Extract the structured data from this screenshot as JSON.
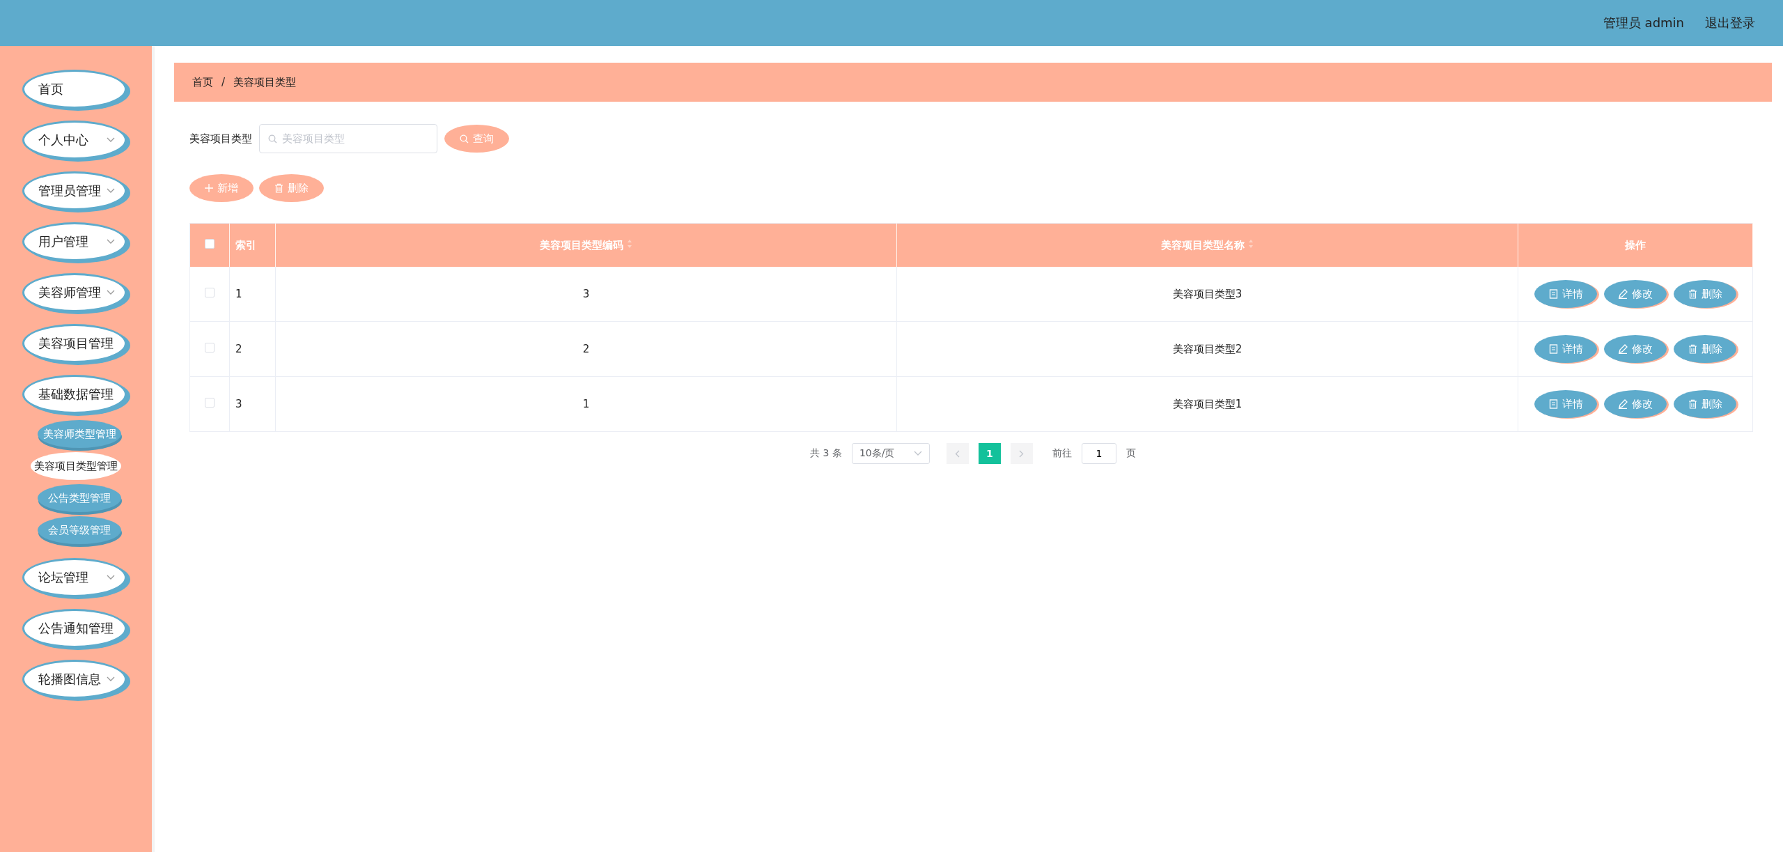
{
  "header": {
    "user": "管理员 admin",
    "logout": "退出登录"
  },
  "sidebar": {
    "items": [
      {
        "label": "首页",
        "has_arrow": false
      },
      {
        "label": "个人中心",
        "has_arrow": true
      },
      {
        "label": "管理员管理",
        "has_arrow": true
      },
      {
        "label": "用户管理",
        "has_arrow": true
      },
      {
        "label": "美容师管理",
        "has_arrow": true
      },
      {
        "label": "美容项目管理",
        "has_arrow": false
      },
      {
        "label": "基础数据管理",
        "has_arrow": false,
        "children": [
          {
            "label": "美容师类型管理",
            "selected": false
          },
          {
            "label": "美容项目类型管理",
            "selected": true
          },
          {
            "label": "公告类型管理",
            "selected": false
          },
          {
            "label": "会员等级管理",
            "selected": false
          }
        ]
      },
      {
        "label": "论坛管理",
        "has_arrow": true
      },
      {
        "label": "公告通知管理",
        "has_arrow": false
      },
      {
        "label": "轮播图信息",
        "has_arrow": true
      }
    ]
  },
  "breadcrumb": [
    "首页",
    "/",
    "美容项目类型"
  ],
  "search": {
    "label": "美容项目类型",
    "placeholder": "美容项目类型",
    "button": "查询"
  },
  "actions": [
    "新增",
    "删除"
  ],
  "table": {
    "select_all_checked": false,
    "columns": [
      "索引",
      "美容项目类型编码",
      "美容项目类型名称",
      "操作"
    ],
    "rows": [
      {
        "checked": false,
        "index": "1",
        "code": "3",
        "name": "美容项目类型3",
        "buttons": [
          "详情",
          "修改",
          "删除"
        ]
      },
      {
        "checked": false,
        "index": "2",
        "code": "2",
        "name": "美容项目类型2",
        "buttons": [
          "详情",
          "修改",
          "删除"
        ]
      },
      {
        "checked": false,
        "index": "3",
        "code": "1",
        "name": "美容项目类型1",
        "buttons": [
          "详情",
          "修改",
          "删除"
        ]
      }
    ]
  },
  "pagination": {
    "total": "共 3 条",
    "page_size": "10条/页",
    "pages": [
      {
        "label": "1",
        "selected": true
      }
    ],
    "goto_label": "前往",
    "goto_value": "1",
    "goto_suffix": "页"
  }
}
